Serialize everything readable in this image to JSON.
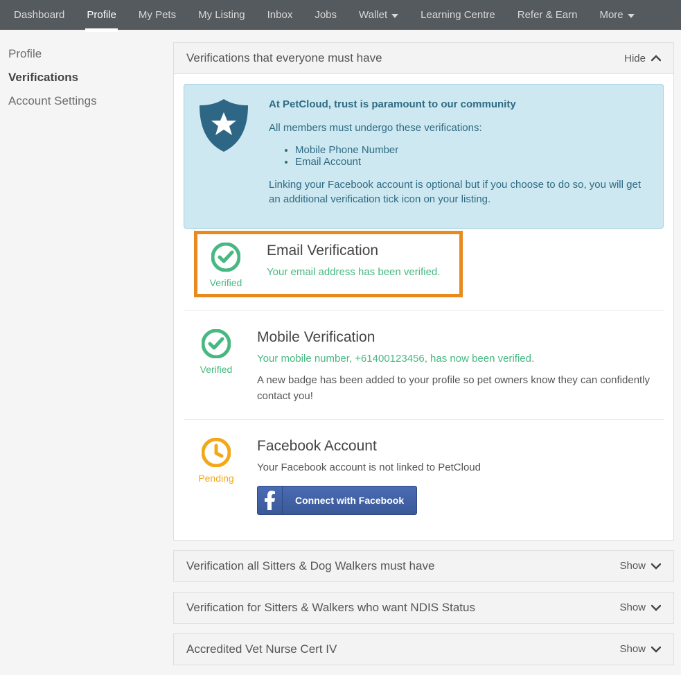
{
  "nav": {
    "items": [
      "Dashboard",
      "Profile",
      "My Pets",
      "My Listing",
      "Inbox",
      "Jobs",
      "Wallet",
      "Learning Centre",
      "Refer & Earn",
      "More"
    ]
  },
  "sidebar": {
    "items": [
      "Profile",
      "Verifications",
      "Account Settings"
    ]
  },
  "panel1": {
    "title": "Verifications that everyone must have",
    "toggle": "Hide"
  },
  "info": {
    "heading": "At PetCloud, trust is paramount to our community",
    "line1": "All members must undergo these verifications:",
    "bullets": [
      "Mobile Phone Number",
      "Email Account"
    ],
    "line2": "Linking your Facebook account is optional but if you choose to do so, you will get an additional verification tick icon on your listing."
  },
  "email": {
    "status": "Verified",
    "title": "Email Verification",
    "msg": "Your email address has been verified."
  },
  "mobile": {
    "status": "Verified",
    "title": "Mobile Verification",
    "msg": "Your mobile number, +61400123456, has now been verified.",
    "desc": "A new badge has been added to your profile so pet owners know they can confidently contact you!"
  },
  "facebook": {
    "status": "Pending",
    "title": "Facebook Account",
    "desc": "Your Facebook account is not linked to PetCloud",
    "button": "Connect with Facebook"
  },
  "panel2": {
    "title": "Verification all Sitters & Dog Walkers must have",
    "toggle": "Show"
  },
  "panel3": {
    "title": "Verification for Sitters & Walkers who want NDIS Status",
    "toggle": "Show"
  },
  "panel4": {
    "title": "Accredited Vet Nurse Cert IV",
    "toggle": "Show"
  }
}
